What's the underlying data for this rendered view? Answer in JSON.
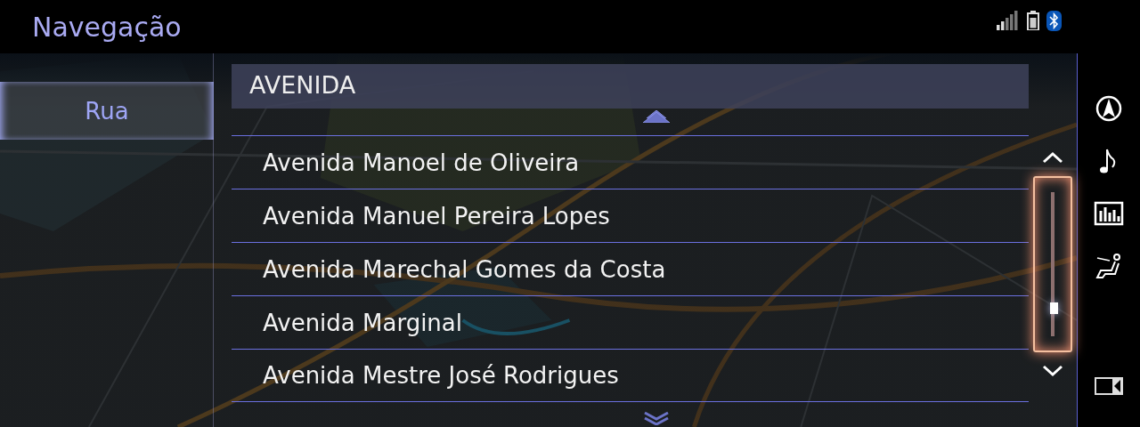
{
  "header": {
    "title": "Navegação"
  },
  "category_tabs": [
    {
      "label": "Rua",
      "selected": true
    }
  ],
  "search": {
    "value": "AVENIDA"
  },
  "results": [
    {
      "label": "Avenida Manoel de Oliveira"
    },
    {
      "label": "Avenida Manuel Pereira Lopes"
    },
    {
      "label": "Avenida Marechal Gomes da Costa"
    },
    {
      "label": "Avenida Marginal"
    },
    {
      "label": "Avenida Mestre José Rodrigues"
    }
  ],
  "sidebar": [
    {
      "kind": "navigation"
    },
    {
      "kind": "music"
    },
    {
      "kind": "equalizer"
    },
    {
      "kind": "seat"
    },
    {
      "kind": "display"
    }
  ]
}
